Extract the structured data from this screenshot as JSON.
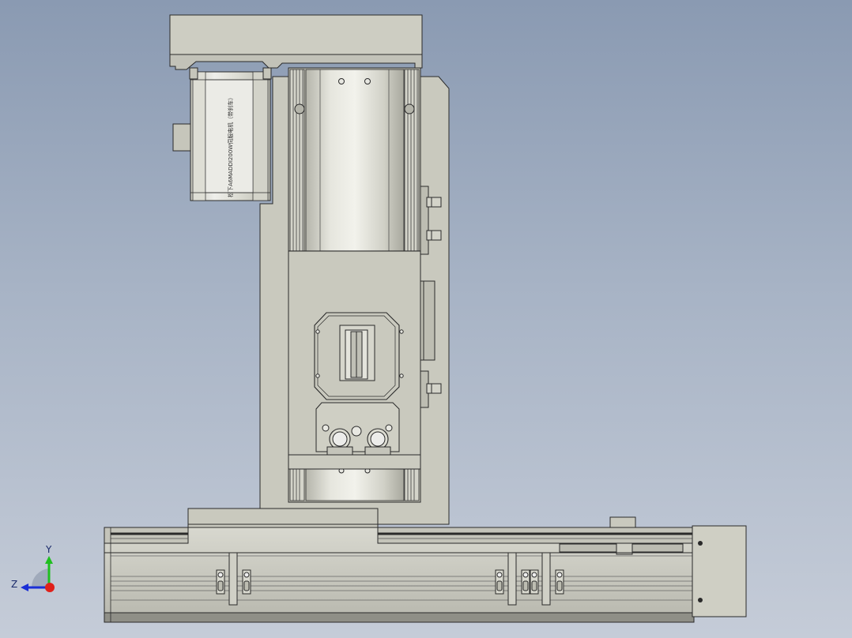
{
  "viewport": {
    "background_top": "#8a9ab2",
    "background_bottom": "#c5ccd8"
  },
  "motor": {
    "label": "松下A6MADDI200W伺服电机（带刹车）"
  },
  "triad": {
    "y_label": "Y",
    "z_label": "Z",
    "y_color": "#1fbf1f",
    "z_color": "#1a2fd6",
    "x_color": "#e0201a"
  },
  "colors": {
    "body": "#ccccc1",
    "body_light": "#d9d9cf",
    "body_dark": "#a9a99f",
    "line": "#2a2a2a",
    "shine": "#ececea"
  }
}
